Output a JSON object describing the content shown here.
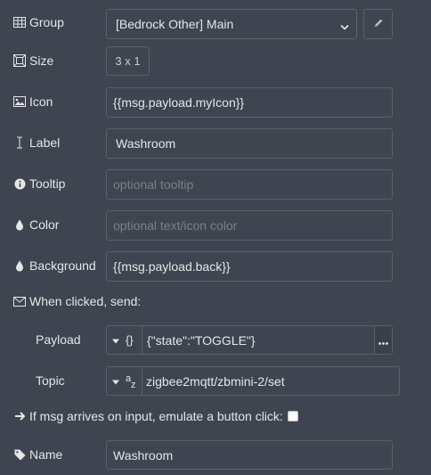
{
  "group": {
    "label": "Group",
    "value": "[Bedrock Other] Main"
  },
  "size": {
    "label": "Size",
    "value": "3 x 1"
  },
  "icon": {
    "label": "Icon",
    "value": "{{msg.payload.myIcon}}"
  },
  "label": {
    "label": "Label",
    "value": "Washroom"
  },
  "tooltip": {
    "label": "Tooltip",
    "placeholder": "optional tooltip"
  },
  "color": {
    "label": "Color",
    "placeholder": "optional text/icon color"
  },
  "background": {
    "label": "Background",
    "value": "{{msg.payload.back}}"
  },
  "when_clicked": {
    "label": "When clicked, send:"
  },
  "payload": {
    "label": "Payload",
    "type_glyph": "{}",
    "value": "{\"state\":\"TOGGLE\"}"
  },
  "topic": {
    "label": "Topic",
    "type_glyph_a": "a",
    "type_glyph_z": "z",
    "value": "zigbee2mqtt/zbmini-2/set"
  },
  "emulate": {
    "label": "If msg arrives on input, emulate a button click:",
    "checked": false
  },
  "name": {
    "label": "Name",
    "value": "Washroom"
  },
  "colors": {
    "bg": "#3e4450",
    "border": "#5b616b",
    "text": "#e6e6e6",
    "placeholder": "#7b8089"
  }
}
